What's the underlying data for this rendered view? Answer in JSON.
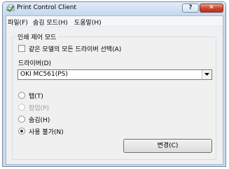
{
  "window": {
    "title": "Print Control Client",
    "help_label": "?",
    "close_label": "✕"
  },
  "menu": {
    "items": [
      "파일(F)",
      "숨김 모드(H)",
      "도움말(H)"
    ]
  },
  "group": {
    "title": "인쇄 제어 모드",
    "same_model_checkbox": {
      "label": "같은 모델의 모든 드라이버 선택(A)",
      "checked": false
    },
    "driver_label": "드라이버(D)",
    "driver_value": "OKI MC561(PS)",
    "modes": [
      {
        "label": "탭(T)",
        "checked": false,
        "enabled": true
      },
      {
        "label": "팝업(P)",
        "checked": false,
        "enabled": false
      },
      {
        "label": "숨김(H)",
        "checked": false,
        "enabled": true
      },
      {
        "label": "사용 불가(N)",
        "checked": true,
        "enabled": true
      }
    ],
    "change_button": "변경(C)"
  }
}
